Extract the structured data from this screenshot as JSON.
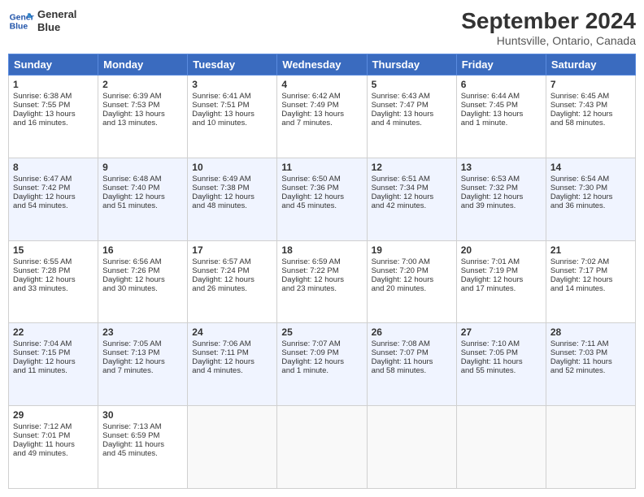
{
  "header": {
    "logo_line1": "General",
    "logo_line2": "Blue",
    "month": "September 2024",
    "location": "Huntsville, Ontario, Canada"
  },
  "days_of_week": [
    "Sunday",
    "Monday",
    "Tuesday",
    "Wednesday",
    "Thursday",
    "Friday",
    "Saturday"
  ],
  "weeks": [
    [
      {
        "day": "1",
        "info": "Sunrise: 6:38 AM\nSunset: 7:55 PM\nDaylight: 13 hours\nand 16 minutes."
      },
      {
        "day": "2",
        "info": "Sunrise: 6:39 AM\nSunset: 7:53 PM\nDaylight: 13 hours\nand 13 minutes."
      },
      {
        "day": "3",
        "info": "Sunrise: 6:41 AM\nSunset: 7:51 PM\nDaylight: 13 hours\nand 10 minutes."
      },
      {
        "day": "4",
        "info": "Sunrise: 6:42 AM\nSunset: 7:49 PM\nDaylight: 13 hours\nand 7 minutes."
      },
      {
        "day": "5",
        "info": "Sunrise: 6:43 AM\nSunset: 7:47 PM\nDaylight: 13 hours\nand 4 minutes."
      },
      {
        "day": "6",
        "info": "Sunrise: 6:44 AM\nSunset: 7:45 PM\nDaylight: 13 hours\nand 1 minute."
      },
      {
        "day": "7",
        "info": "Sunrise: 6:45 AM\nSunset: 7:43 PM\nDaylight: 12 hours\nand 58 minutes."
      }
    ],
    [
      {
        "day": "8",
        "info": "Sunrise: 6:47 AM\nSunset: 7:42 PM\nDaylight: 12 hours\nand 54 minutes."
      },
      {
        "day": "9",
        "info": "Sunrise: 6:48 AM\nSunset: 7:40 PM\nDaylight: 12 hours\nand 51 minutes."
      },
      {
        "day": "10",
        "info": "Sunrise: 6:49 AM\nSunset: 7:38 PM\nDaylight: 12 hours\nand 48 minutes."
      },
      {
        "day": "11",
        "info": "Sunrise: 6:50 AM\nSunset: 7:36 PM\nDaylight: 12 hours\nand 45 minutes."
      },
      {
        "day": "12",
        "info": "Sunrise: 6:51 AM\nSunset: 7:34 PM\nDaylight: 12 hours\nand 42 minutes."
      },
      {
        "day": "13",
        "info": "Sunrise: 6:53 AM\nSunset: 7:32 PM\nDaylight: 12 hours\nand 39 minutes."
      },
      {
        "day": "14",
        "info": "Sunrise: 6:54 AM\nSunset: 7:30 PM\nDaylight: 12 hours\nand 36 minutes."
      }
    ],
    [
      {
        "day": "15",
        "info": "Sunrise: 6:55 AM\nSunset: 7:28 PM\nDaylight: 12 hours\nand 33 minutes."
      },
      {
        "day": "16",
        "info": "Sunrise: 6:56 AM\nSunset: 7:26 PM\nDaylight: 12 hours\nand 30 minutes."
      },
      {
        "day": "17",
        "info": "Sunrise: 6:57 AM\nSunset: 7:24 PM\nDaylight: 12 hours\nand 26 minutes."
      },
      {
        "day": "18",
        "info": "Sunrise: 6:59 AM\nSunset: 7:22 PM\nDaylight: 12 hours\nand 23 minutes."
      },
      {
        "day": "19",
        "info": "Sunrise: 7:00 AM\nSunset: 7:20 PM\nDaylight: 12 hours\nand 20 minutes."
      },
      {
        "day": "20",
        "info": "Sunrise: 7:01 AM\nSunset: 7:19 PM\nDaylight: 12 hours\nand 17 minutes."
      },
      {
        "day": "21",
        "info": "Sunrise: 7:02 AM\nSunset: 7:17 PM\nDaylight: 12 hours\nand 14 minutes."
      }
    ],
    [
      {
        "day": "22",
        "info": "Sunrise: 7:04 AM\nSunset: 7:15 PM\nDaylight: 12 hours\nand 11 minutes."
      },
      {
        "day": "23",
        "info": "Sunrise: 7:05 AM\nSunset: 7:13 PM\nDaylight: 12 hours\nand 7 minutes."
      },
      {
        "day": "24",
        "info": "Sunrise: 7:06 AM\nSunset: 7:11 PM\nDaylight: 12 hours\nand 4 minutes."
      },
      {
        "day": "25",
        "info": "Sunrise: 7:07 AM\nSunset: 7:09 PM\nDaylight: 12 hours\nand 1 minute."
      },
      {
        "day": "26",
        "info": "Sunrise: 7:08 AM\nSunset: 7:07 PM\nDaylight: 11 hours\nand 58 minutes."
      },
      {
        "day": "27",
        "info": "Sunrise: 7:10 AM\nSunset: 7:05 PM\nDaylight: 11 hours\nand 55 minutes."
      },
      {
        "day": "28",
        "info": "Sunrise: 7:11 AM\nSunset: 7:03 PM\nDaylight: 11 hours\nand 52 minutes."
      }
    ],
    [
      {
        "day": "29",
        "info": "Sunrise: 7:12 AM\nSunset: 7:01 PM\nDaylight: 11 hours\nand 49 minutes."
      },
      {
        "day": "30",
        "info": "Sunrise: 7:13 AM\nSunset: 6:59 PM\nDaylight: 11 hours\nand 45 minutes."
      },
      {
        "day": "",
        "info": ""
      },
      {
        "day": "",
        "info": ""
      },
      {
        "day": "",
        "info": ""
      },
      {
        "day": "",
        "info": ""
      },
      {
        "day": "",
        "info": ""
      }
    ]
  ]
}
